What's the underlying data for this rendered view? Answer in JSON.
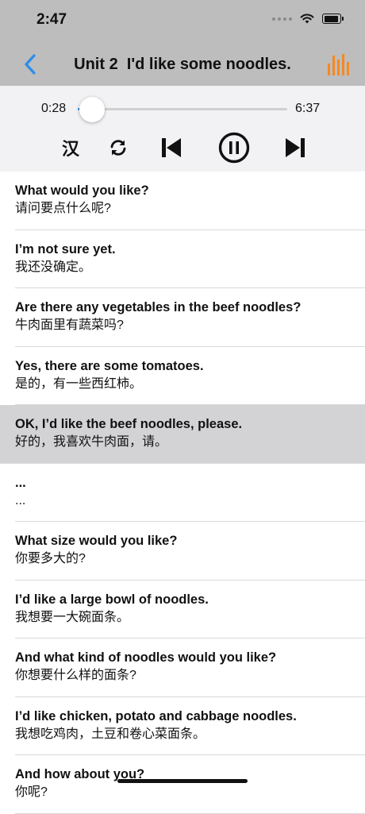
{
  "status_bar": {
    "time": "2:47"
  },
  "nav": {
    "title": "Unit 2  I'd like some noodles."
  },
  "player": {
    "current_time": "0:28",
    "total_time": "6:37",
    "progress": 0.07,
    "chinese_label": "汉"
  },
  "colors": {
    "accent": "#2b8ee8",
    "audio_icon": "#f5891f",
    "active_row": "#d3d3d6"
  },
  "icons": [
    "wifi-icon",
    "battery-icon",
    "back-arrow-icon",
    "audio-bars-icon",
    "repeat-icon",
    "skip-previous-icon",
    "pause-icon",
    "skip-next-icon"
  ],
  "sentences": [
    {
      "en": "What would you like?",
      "zh": "请问要点什么呢?"
    },
    {
      "en": "I’m not sure yet.",
      "zh": "我还没确定。"
    },
    {
      "en": "Are there any vegetables in the beef noodles?",
      "zh": "牛肉面里有蔬菜吗?"
    },
    {
      "en": "Yes, there are some tomatoes.",
      "zh": "是的，有一些西红柿。"
    },
    {
      "en": "OK, I’d like the beef noodles, please.",
      "zh": "好的，我喜欢牛肉面，请。",
      "active": true
    },
    {
      "en": "...",
      "zh": "..."
    },
    {
      "en": "What size would you like?",
      "zh": "你要多大的?"
    },
    {
      "en": "I’d like a large bowl of noodles.",
      "zh": "我想要一大碗面条。"
    },
    {
      "en": "And what kind of noodles would you like?",
      "zh": "你想要什么样的面条?"
    },
    {
      "en": "I’d like chicken, potato and cabbage noodles.",
      "zh": "我想吃鸡肉，土豆和卷心菜面条。"
    },
    {
      "en": "And how about you?",
      "zh": "你呢?"
    }
  ]
}
